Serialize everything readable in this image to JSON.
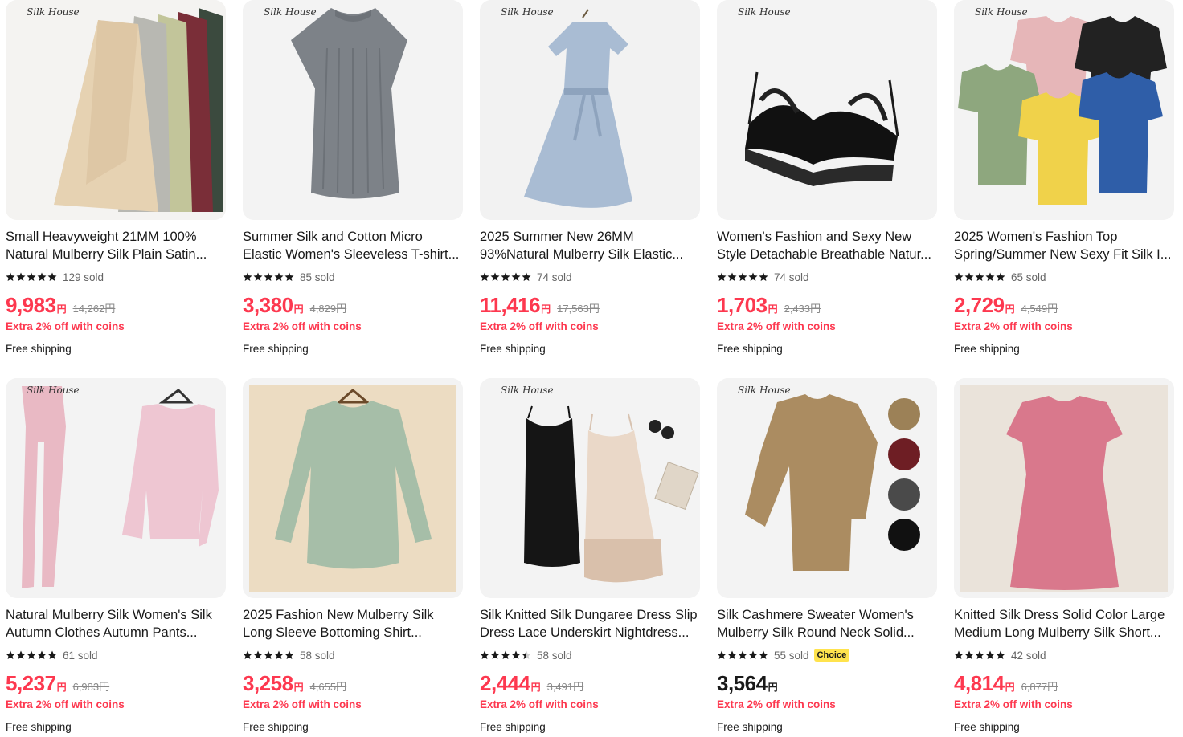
{
  "brand_text": "Silk House",
  "coins_text": "Extra 2% off with coins",
  "shipping_text": "Free shipping",
  "choice_badge": "Choice",
  "colors": {
    "price_red": "#fd384f",
    "price_black": "#191919",
    "choice_yellow": "#ffe34d"
  },
  "products": [
    {
      "title_line1": "Small Heavyweight 21MM 100%",
      "title_line2": "Natural Mulberry Silk Plain Satin...",
      "sold": "129 sold",
      "price": "9,983",
      "currency": "円",
      "original": "14,262円"
    },
    {
      "title_line1": "Summer Silk and Cotton Micro",
      "title_line2": "Elastic Women's Sleeveless T-shirt...",
      "sold": "85 sold",
      "price": "3,380",
      "currency": "円",
      "original": "4,829円"
    },
    {
      "title_line1": "2025 Summer New 26MM",
      "title_line2": "93%Natural Mulberry Silk Elastic...",
      "sold": "74 sold",
      "price": "11,416",
      "currency": "円",
      "original": "17,563円"
    },
    {
      "title_line1": "Women's Fashion and Sexy New",
      "title_line2": "Style Detachable Breathable Natur...",
      "sold": "74 sold",
      "price": "1,703",
      "currency": "円",
      "original": "2,433円"
    },
    {
      "title_line1": "2025 Women's Fashion Top",
      "title_line2": "Spring/Summer New Sexy Fit Silk I...",
      "sold": "65 sold",
      "price": "2,729",
      "currency": "円",
      "original": "4,549円"
    },
    {
      "title_line1": "Natural Mulberry Silk Women's Silk",
      "title_line2": "Autumn Clothes Autumn Pants...",
      "sold": "61 sold",
      "price": "5,237",
      "currency": "円",
      "original": "6,983円"
    },
    {
      "title_line1": "2025 Fashion New Mulberry Silk",
      "title_line2": "Long Sleeve Bottoming Shirt...",
      "sold": "58 sold",
      "price": "3,258",
      "currency": "円",
      "original": "4,655円"
    },
    {
      "title_line1": "Silk Knitted Silk Dungaree Dress Slip",
      "title_line2": "Dress Lace Underskirt Nightdress...",
      "sold": "58 sold",
      "price": "2,444",
      "currency": "円",
      "original": "3,491円"
    },
    {
      "title_line1": "Silk Cashmere Sweater Women's",
      "title_line2": "Mulberry Silk Round Neck Solid...",
      "sold": "55 sold",
      "price": "3,564",
      "currency": "円",
      "original": ""
    },
    {
      "title_line1": "Knitted Silk Dress Solid Color Large",
      "title_line2": "Medium Long Mulberry Silk Short...",
      "sold": "42 sold",
      "price": "4,814",
      "currency": "円",
      "original": "6,877円"
    }
  ]
}
